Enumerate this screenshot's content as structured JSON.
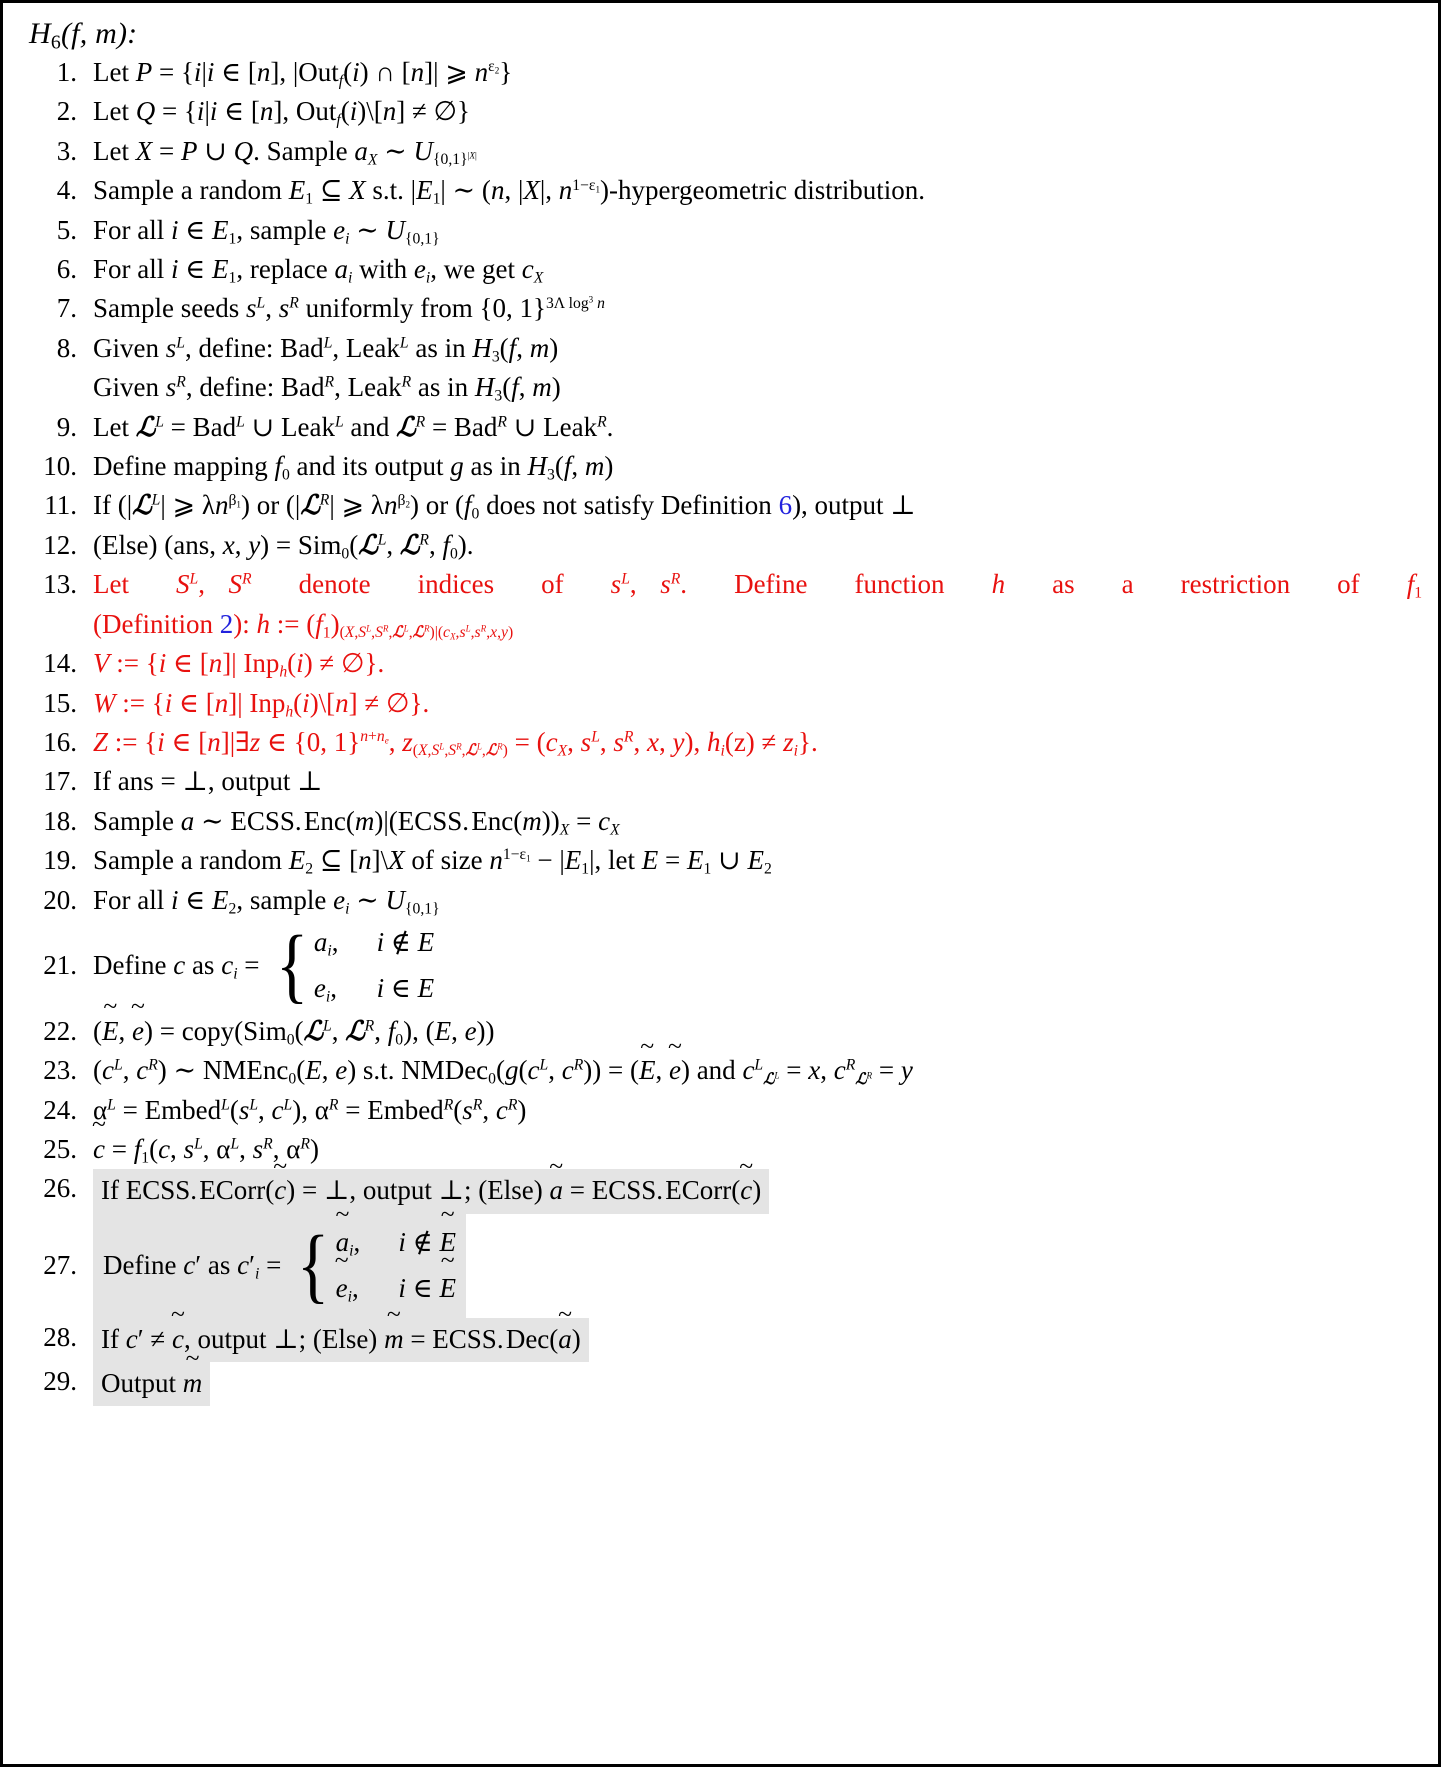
{
  "title": {
    "name": "H",
    "sub": "6",
    "args": "(f, m):"
  },
  "colors": {
    "red": "#e8110f",
    "blue": "#2222dd",
    "highlight": "#e4e4e4",
    "text": "#000000",
    "border": "#000000",
    "background": "#ffffff"
  },
  "steps": [
    {
      "n": "1.",
      "text": "Let P = {i|i ∈ [n], |Out_f(i) ∩ [n]| ⩾ n^{ε_2}}"
    },
    {
      "n": "2.",
      "text": "Let Q = {i|i ∈ [n], Out_f(i)\\[n] ≠ ∅}"
    },
    {
      "n": "3.",
      "text": "Let X = P ∪ Q. Sample a_X ∼ U_{{0,1}^{|X|}}"
    },
    {
      "n": "4.",
      "text": "Sample a random E_1 ⊆ X s.t. |E_1| ∼ (n, |X|, n^{1−ε_1})-hypergeometric distribution."
    },
    {
      "n": "5.",
      "text": "For all i ∈ E_1, sample e_i ∼ U_{{0,1}}"
    },
    {
      "n": "6.",
      "text": "For all i ∈ E_1, replace a_i with e_i, we get c_X"
    },
    {
      "n": "7.",
      "text": "Sample seeds s^L, s^R uniformly from {0,1}^{3Λ log^3 n}"
    },
    {
      "n": "8.",
      "text": "Given s^L, define: Bad^L, Leak^L as in H_3(f,m) / Given s^R, define: Bad^R, Leak^R as in H_3(f,m)"
    },
    {
      "n": "9.",
      "text": "Let L^L = Bad^L ∪ Leak^L and L^R = Bad^R ∪ Leak^R."
    },
    {
      "n": "10.",
      "text": "Define mapping f_0 and its output g as in H_3(f,m)"
    },
    {
      "n": "11.",
      "text": "If (|L^L| ⩾ λn^{β_1}) or (|L^R| ⩾ λn^{β_2}) or (f_0 does not satisfy Definition 6), output ⊥"
    },
    {
      "n": "12.",
      "text": "(Else) (ans, x, y) = Sim_0(L^L, L^R, f_0)."
    },
    {
      "n": "13.",
      "text": "Let S^L, S^R denote indices of s^L, s^R. Define function h as a restriction of f_1 (Definition 2): h := (f_1)_{(X,S^L,S^R,L^L,L^R)|(c_X,s^L,s^R,x,y)}"
    },
    {
      "n": "14.",
      "text": "V := {i ∈ [n]| Inp_h(i) ≠ ∅}."
    },
    {
      "n": "15.",
      "text": "W := {i ∈ [n]| Inp_h(i)\\[n] ≠ ∅}."
    },
    {
      "n": "16.",
      "text": "Z := {i ∈ [n]|∃z ∈ {0,1}^{n+n_e}, z_{(X,S^L,S^R,L^L,L^R)} = (c_X, s^L, s^R, x, y), h_i(z) ≠ z_i}."
    },
    {
      "n": "17.",
      "text": "If ans = ⊥, output ⊥"
    },
    {
      "n": "18.",
      "text": "Sample a ∼ ECSS.Enc(m)|(ECSS.Enc(m))_X = c_X"
    },
    {
      "n": "19.",
      "text": "Sample a random E_2 ⊆ [n]\\X of size n^{1−ε_1} − |E_1|, let E = E_1 ∪ E_2"
    },
    {
      "n": "20.",
      "text": "For all i ∈ E_2, sample e_i ∼ U_{{0,1}}"
    },
    {
      "n": "21.",
      "text": "Define c as c_i = { a_i, i ∉ E ; e_i, i ∈ E }"
    },
    {
      "n": "22.",
      "text": "(Ẽ, ẽ) = copy(Sim_0(L^L, L^R, f_0), (E, e))"
    },
    {
      "n": "23.",
      "text": "(c^L, c^R) ∼ NMEnc_0(E, e) s.t. NMDec_0(g(c^L, c^R)) = (Ẽ, ẽ) and c^L_{L^L} = x, c^R_{L^R} = y"
    },
    {
      "n": "24.",
      "text": "α^L = Embed^L(s^L, c^L), α^R = Embed^R(s^R, c^R)"
    },
    {
      "n": "25.",
      "text": "c̃ = f_1(c, s^L, α^L, s^R, α^R)"
    },
    {
      "n": "26.",
      "text": "If ECSS.ECorr(c̃) = ⊥, output ⊥; (Else) ã = ECSS.ECorr(c̃)"
    },
    {
      "n": "27.",
      "text": "Define c′ as c′_i = { ã_i, i ∉ Ẽ ; ẽ_i, i ∈ Ẽ }"
    },
    {
      "n": "28.",
      "text": "If c′ ≠ c̃, output ⊥; (Else) m̃ = ECSS.Dec(ã)"
    },
    {
      "n": "29.",
      "text": "Output m̃"
    }
  ],
  "literals": {
    "let": "Let",
    "sample": "Sample",
    "sample_a_random": "Sample a random",
    "st": "s.t.",
    "hypergeometric": "-hypergeometric distribution.",
    "for_all": "For all",
    "comma_sample": ", sample",
    "comma_replace": ", replace",
    "with": "with",
    "we_get": ", we get",
    "sample_seeds": "Sample seeds",
    "uniformly_from": "uniformly from",
    "given": "Given",
    "define_colon": ", define:",
    "as_in": "as in",
    "and": "and",
    "define_mapping": "Define mapping",
    "and_its_output": "and its output",
    "if": "If",
    "or": "or",
    "does_not_satisfy": "does not satisfy Definition",
    "output": "output",
    "else": "(Else)",
    "ans": "ans",
    "denote_indices_of": "denote indices of",
    "define_function": "Define function",
    "as_a_restriction_of": "as a restriction of",
    "definition": "Definition",
    "if_ans": "If ans",
    "of_size": "of size",
    "let_e": ", let",
    "define_c_as": "Define c as",
    "copy": "copy",
    "not_in": "∉",
    "in": "∈",
    "output_m": "Output"
  },
  "symbols": {
    "bot": "⊥",
    "emptyset": "∅",
    "in": "∈",
    "notin": "∉",
    "subseteq": "⊆",
    "cup": "∪",
    "cap": "∩",
    "geq": "⩾",
    "neq": "≠",
    "sim": "∼",
    "exists": "∃",
    "setminus": "\\",
    "assign": ":=",
    "lambda": "λ",
    "Lambda": "Λ",
    "alpha": "α",
    "epsilon": "ε",
    "beta": "β",
    "tilde": "~"
  },
  "functions": {
    "Out": "Out",
    "Inp": "Inp",
    "Bad": "Bad",
    "Leak": "Leak",
    "Sim": "Sim",
    "ECSS": "ECSS.",
    "Enc": "Enc",
    "Dec": "Dec",
    "ECorr": "ECorr",
    "NMEnc": "NMEnc",
    "NMDec": "NMDec",
    "Embed": "Embed",
    "copy": "copy",
    "log": "log",
    "U": "U"
  },
  "refs": {
    "definition6": "6",
    "definition2": "2"
  }
}
